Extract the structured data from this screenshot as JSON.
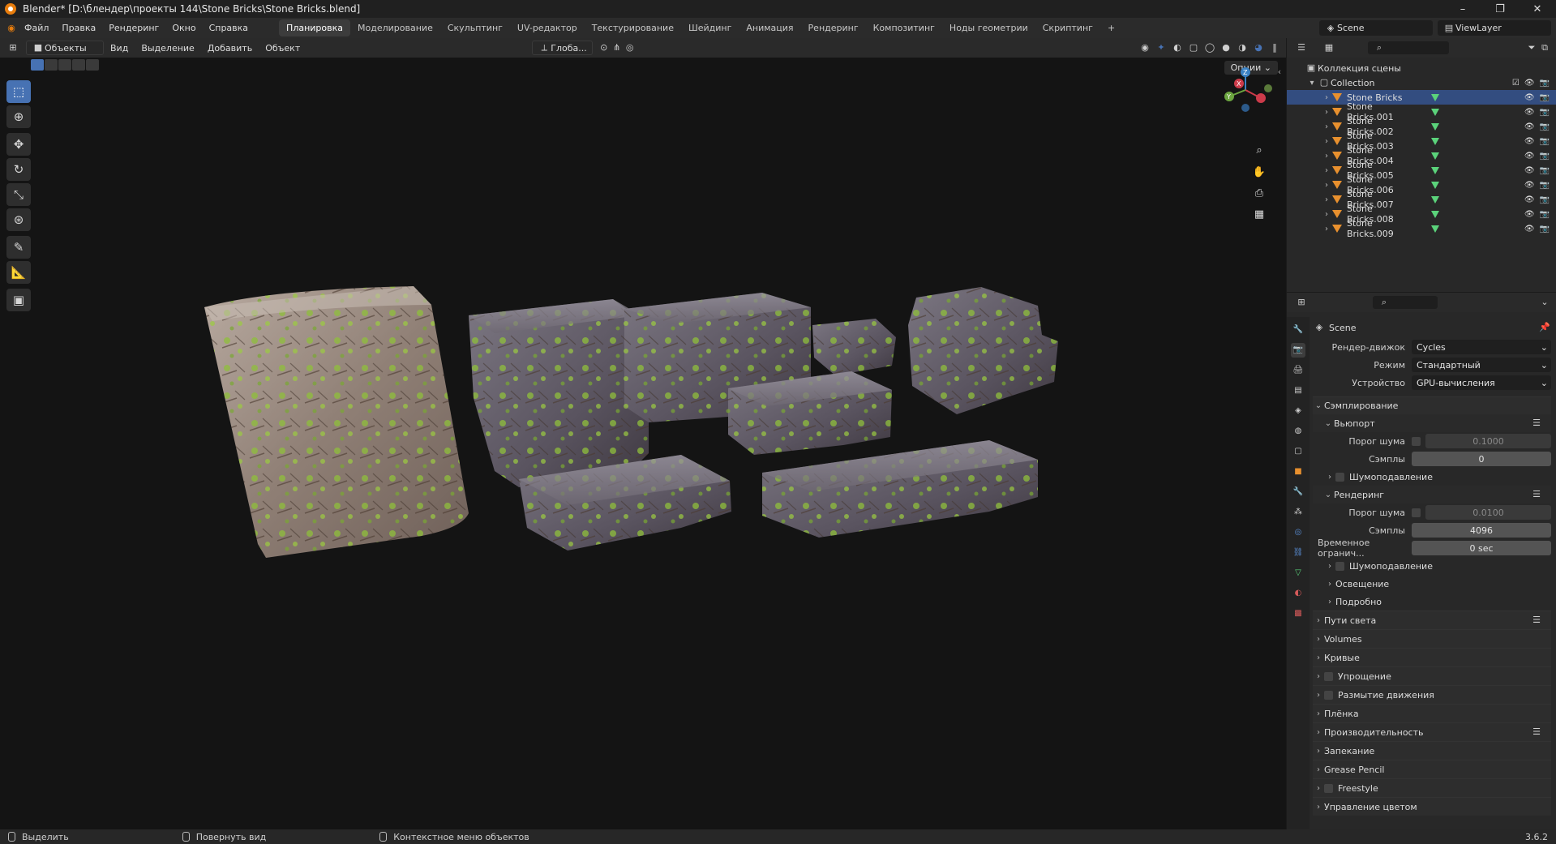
{
  "window": {
    "title": "Blender* [D:\\блендер\\проекты 144\\Stone Bricks\\Stone Bricks.blend]",
    "min": "–",
    "restore": "❐",
    "close": "✕"
  },
  "menu": [
    "Файл",
    "Правка",
    "Рендеринг",
    "Окно",
    "Справка"
  ],
  "workspaces": [
    "Планировка",
    "Моделирование",
    "Скульптинг",
    "UV-редактор",
    "Текстурирование",
    "Шейдинг",
    "Анимация",
    "Рендеринг",
    "Композитинг",
    "Ноды геометрии",
    "Скриптинг",
    "+"
  ],
  "active_workspace": "Планировка",
  "scene": {
    "name": "Scene",
    "view_layer": "ViewLayer"
  },
  "viewport_header": {
    "mode": "Объекты",
    "menus": [
      "Вид",
      "Выделение",
      "Добавить",
      "Объект"
    ],
    "orientation": "Глоба...",
    "options": "Опции"
  },
  "outliner": {
    "root": "Коллекция сцены",
    "collection": "Collection",
    "items": [
      "Stone Bricks",
      "Stone Bricks.001",
      "Stone Bricks.002",
      "Stone Bricks.003",
      "Stone Bricks.004",
      "Stone Bricks.005",
      "Stone Bricks.006",
      "Stone Bricks.007",
      "Stone Bricks.008",
      "Stone Bricks.009"
    ],
    "selected_index": 0
  },
  "properties": {
    "context": "Scene",
    "render_engine_label": "Рендер-движок",
    "render_engine": "Cycles",
    "mode_label": "Режим",
    "mode": "Стандартный",
    "device_label": "Устройство",
    "device": "GPU-вычисления",
    "sampling": "Сэмплирование",
    "viewport": "Вьюпорт",
    "noise_threshold_label": "Порог шума",
    "viewport_noise": "0.1000",
    "samples_label": "Сэмплы",
    "viewport_samples": "0",
    "denoise": "Шумоподавление",
    "render": "Рендеринг",
    "render_noise": "0.0100",
    "render_samples": "4096",
    "time_limit_label": "Временное огранич...",
    "time_limit": "0 sec",
    "lighting": "Освещение",
    "advanced": "Подробно",
    "panels": [
      "Пути света",
      "Volumes",
      "Кривые",
      "Упрощение",
      "Размытие движения",
      "Плёнка",
      "Производительность",
      "Запекание",
      "Grease Pencil",
      "Freestyle",
      "Управление цветом"
    ]
  },
  "status": {
    "select": "Выделить",
    "rotate": "Повернуть вид",
    "context": "Контекстное меню объектов",
    "version": "3.6.2"
  },
  "colors": {
    "accent": "#4772b3",
    "selected_row": "#334d80",
    "object_icon": "#e8902e",
    "mesh_icon": "#5bd37b"
  }
}
